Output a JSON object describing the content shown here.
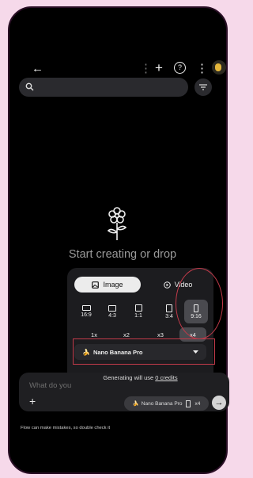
{
  "topbar": {
    "back_glyph": "←",
    "add_glyph": "+",
    "help_glyph": "?",
    "more_glyph": "⋮"
  },
  "search": {
    "placeholder": ""
  },
  "hero": {
    "text": "Start creating or drop"
  },
  "popup": {
    "tabs": [
      {
        "label": "Image",
        "icon": "image-icon",
        "selected": true
      },
      {
        "label": "Video",
        "icon": "play-icon",
        "selected": false
      }
    ],
    "ratios": [
      {
        "label": "16:9",
        "selected": false
      },
      {
        "label": "4:3",
        "selected": false
      },
      {
        "label": "1:1",
        "selected": false
      },
      {
        "label": "3:4",
        "selected": false
      },
      {
        "label": "9:16",
        "selected": true
      }
    ],
    "multipliers": [
      {
        "label": "1x",
        "selected": false
      },
      {
        "label": "x2",
        "selected": false
      },
      {
        "label": "x3",
        "selected": false
      },
      {
        "label": "x4",
        "selected": true
      }
    ],
    "model": {
      "emoji": "🍌",
      "label": "Nano Banana Pro"
    },
    "credits": {
      "prefix": "Generating will use ",
      "link": "0 credits"
    }
  },
  "composer": {
    "placeholder": "What do you",
    "plus_glyph": "+",
    "chip": {
      "emoji": "🍌",
      "label": "Nano Banana Pro",
      "count": "x4"
    },
    "send_glyph": "→"
  },
  "disclaimer": "Flow can make mistakes, so double check it",
  "colors": {
    "highlight": "#c23a4a",
    "selected_bg": "#4a4a4f",
    "tab_selected": "#ececec"
  }
}
